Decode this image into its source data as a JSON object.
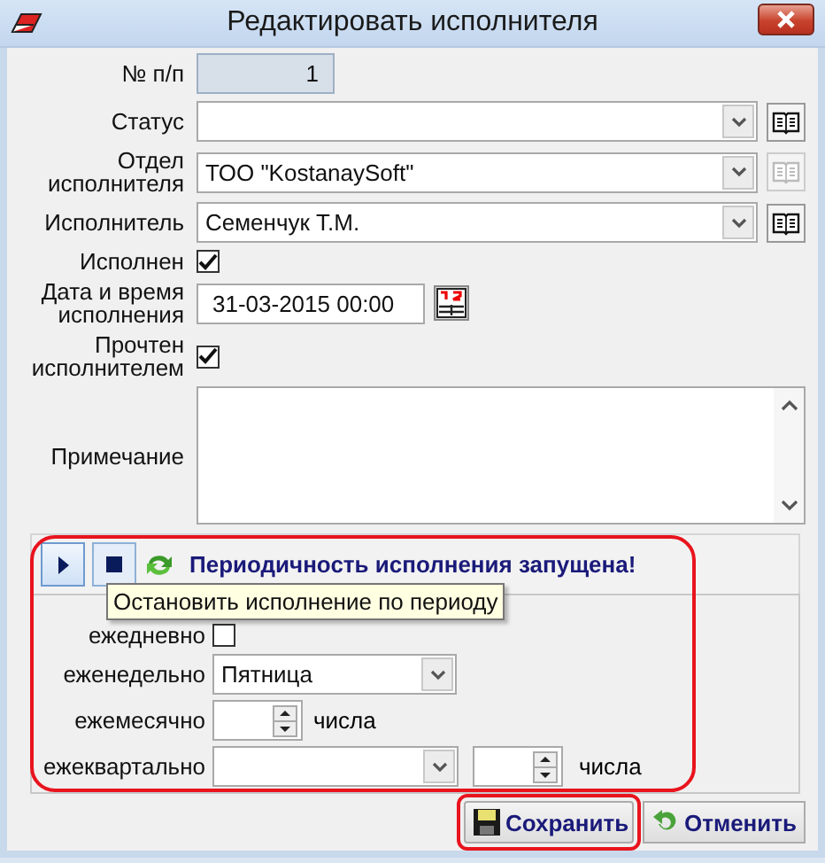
{
  "window": {
    "title": "Редактировать исполнителя"
  },
  "fields": [
    {
      "kind": "number",
      "label": "№ п/п",
      "value": "1",
      "disabled": true
    },
    {
      "kind": "combo",
      "label": "Статус",
      "lookup_disabled": false
    },
    {
      "kind": "combo",
      "label": "Отдел исполнителя",
      "value": "ТОО \"KostanaySoft\"",
      "lookup_disabled": true
    },
    {
      "kind": "combo",
      "label": "Исполнитель",
      "value": "Семенчук Т.М.",
      "lookup_disabled": false
    },
    {
      "kind": "check",
      "label": "Исполнен",
      "checked": true
    },
    {
      "kind": "datetime",
      "label": "Дата и время исполнения",
      "value": "31-03-2015 00:00"
    },
    {
      "kind": "check",
      "label": "Прочтен исполнителем",
      "checked": true
    },
    {
      "kind": "memo",
      "label": "Примечание"
    }
  ],
  "periodic": {
    "running": true,
    "status": "Периодичность исполнения запущена!",
    "tooltip": "Остановить исполнение по периоду",
    "schedule": [
      {
        "kind": "check",
        "label": "ежедневно",
        "checked": false
      },
      {
        "kind": "combo",
        "label": "еженедельно",
        "value": "Пятница"
      },
      {
        "kind": "spin",
        "label": "ежемесячно",
        "suffix": "числа"
      },
      {
        "kind": "combospin",
        "label": "ежеквартально",
        "suffix": "числа"
      }
    ]
  },
  "buttons": [
    {
      "kind": "save",
      "label": "Сохранить"
    },
    {
      "kind": "cancel",
      "label": "Отменить"
    }
  ]
}
